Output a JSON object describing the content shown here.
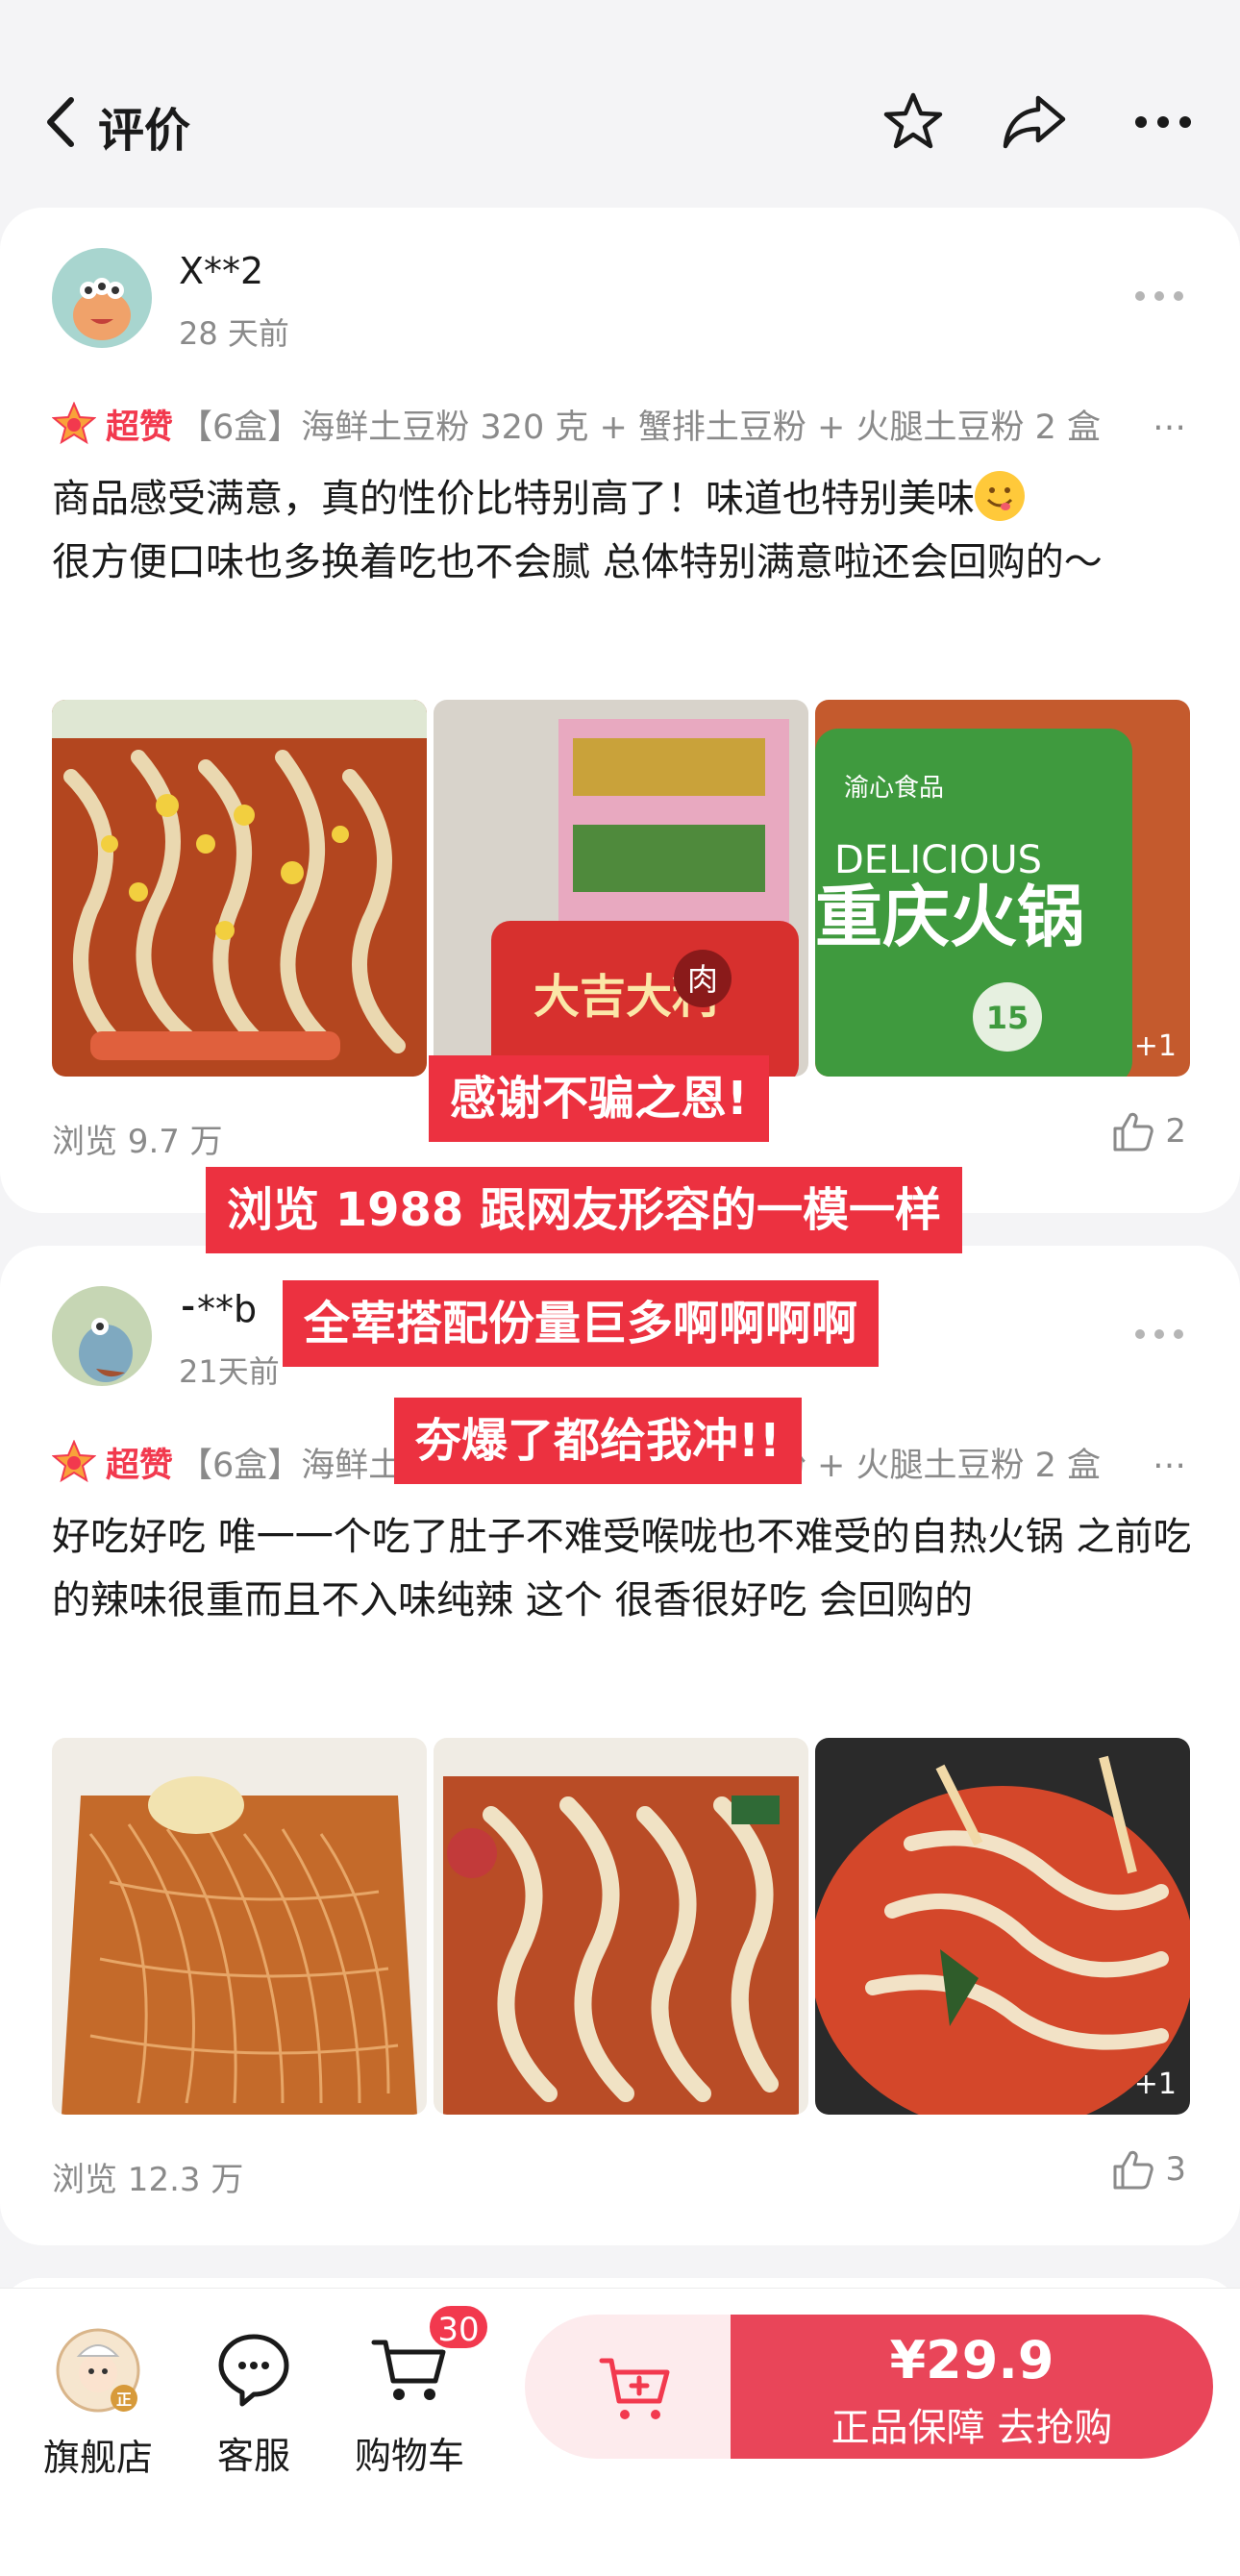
{
  "header": {
    "title": "评价"
  },
  "reviews": [
    {
      "user": "X**2",
      "time": "28 天前",
      "badge": "超赞",
      "sku": "【6盒】海鲜土豆粉 320 克 + 蟹排土豆粉 + 火腿土豆粉 2 盒",
      "text": "商品感受满意，真的性价比特别高了！味道也特别美味",
      "text2": "很方便口味也多换着吃也不会腻 总体特别满意啦还会回购的～",
      "more_photos": "+1",
      "photo2_text": "大吉大利",
      "photo2_tag": "肉",
      "photo3_brand": "渝心食品",
      "photo3_en": "DELICIOUS",
      "photo3_title": "重庆火锅",
      "photo3_mins": "15",
      "views": "浏览 9.7 万",
      "likes": "2"
    },
    {
      "user": "⁃**b",
      "time": "21天前",
      "badge": "超赞",
      "sku": "【6盒】海鲜土豆粉 320 克 + 蟹排土豆粉 + 火腿土豆粉 2 盒",
      "text": "好吃好吃 唯一一个吃了肚子不难受喉咙也不难受的自热火锅 之前吃的辣味很重而且不入味纯辣 这个 很香很好吃 会回购的",
      "more_photos": "+1",
      "views": "浏览 12.3 万",
      "likes": "3"
    }
  ],
  "overlays": [
    "感谢不骗之恩!",
    "浏览 1988 跟网友形容的一模一样",
    "全荤搭配份量巨多啊啊啊啊",
    "夯爆了都给我冲!!"
  ],
  "bottom": {
    "store": "旗舰店",
    "store_tag": "正",
    "service": "客服",
    "cart": "购物车",
    "cart_count": "30",
    "price": "¥29.9",
    "buy_label": "正品保障 去抢购"
  },
  "colors": {
    "accent": "#f2394e",
    "overlay": "#ec3140",
    "buy": "#e94559"
  }
}
